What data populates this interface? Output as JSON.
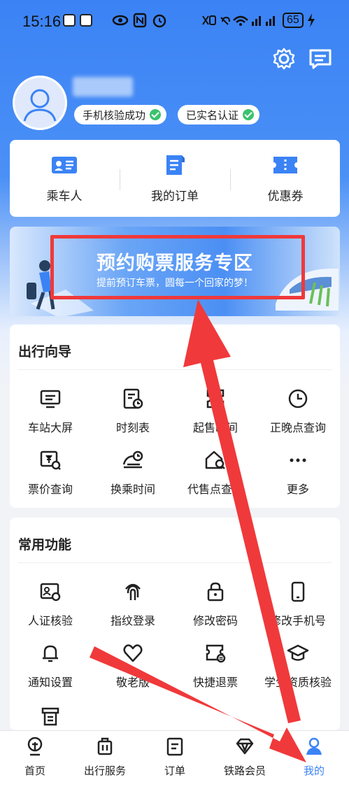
{
  "status_bar": {
    "time": "15:16",
    "battery": "65",
    "network_label": "4G"
  },
  "header": {
    "icons": [
      "settings-icon",
      "message-icon"
    ]
  },
  "profile": {
    "badges": [
      "手机核验成功",
      "已实名认证"
    ]
  },
  "shortcuts": [
    {
      "label": "乘车人",
      "icon": "passenger-card-icon"
    },
    {
      "label": "我的订单",
      "icon": "order-document-icon"
    },
    {
      "label": "优惠券",
      "icon": "coupon-icon"
    }
  ],
  "banner": {
    "title": "预约购票服务专区",
    "subtitle": "提前预订车票，圆每一个回家的梦！"
  },
  "travel_guide": {
    "title": "出行向导",
    "items": [
      {
        "label": "车站大屏",
        "icon": "station-screen-icon"
      },
      {
        "label": "时刻表",
        "icon": "timetable-icon"
      },
      {
        "label": "起售时间",
        "icon": "sale-time-icon"
      },
      {
        "label": "正晚点查询",
        "icon": "clock-icon"
      },
      {
        "label": "票价查询",
        "icon": "fare-query-icon"
      },
      {
        "label": "换乘时间",
        "icon": "transfer-time-icon"
      },
      {
        "label": "代售点查询",
        "icon": "agency-query-icon"
      },
      {
        "label": "更多",
        "icon": "more-dots-icon"
      }
    ]
  },
  "common_functions": {
    "title": "常用功能",
    "items": [
      {
        "label": "人证核验",
        "icon": "id-verify-icon"
      },
      {
        "label": "指纹登录",
        "icon": "fingerprint-icon"
      },
      {
        "label": "修改密码",
        "icon": "lock-icon"
      },
      {
        "label": "修改手机号",
        "icon": "phone-icon"
      },
      {
        "label": "通知设置",
        "icon": "bell-icon"
      },
      {
        "label": "敬老版",
        "icon": "heart-icon"
      },
      {
        "label": "快捷退票",
        "icon": "refund-ticket-icon"
      },
      {
        "label": "学生资质核验",
        "icon": "graduation-cap-icon"
      }
    ],
    "partial_item_icon": "receipt-icon"
  },
  "bottom_nav": [
    {
      "label": "首页",
      "icon": "home-train-icon"
    },
    {
      "label": "出行服务",
      "icon": "luggage-icon"
    },
    {
      "label": "订单",
      "icon": "order-list-icon"
    },
    {
      "label": "铁路会员",
      "icon": "diamond-icon"
    },
    {
      "label": "我的",
      "icon": "user-icon",
      "active": true
    }
  ],
  "colors": {
    "brand_blue": "#3b83f5",
    "annotation_red": "#f0393b",
    "success_green": "#3cc26e"
  }
}
